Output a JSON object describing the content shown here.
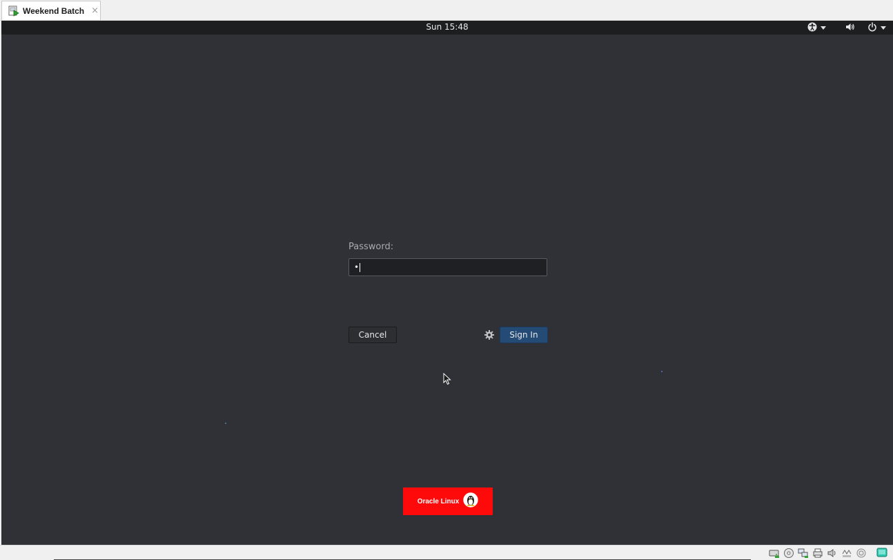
{
  "tab": {
    "label": "Weekend Batch",
    "close_glyph": "×",
    "icon": "vm-running-icon"
  },
  "topbar": {
    "clock": "Sun 15:48",
    "icons": [
      "accessibility-icon",
      "volume-icon",
      "power-icon"
    ]
  },
  "login": {
    "password_label": "Password:",
    "password_value": "•",
    "cancel_label": "Cancel",
    "signin_label": "Sign In",
    "settings_icon": "gear-icon"
  },
  "logo": {
    "text": "Oracle Linux",
    "mascot": "tux-penguin-icon",
    "background": "#ff0a0a"
  },
  "statusbar": {
    "icons": [
      "hard-disk-icon",
      "optical-drive-icon",
      "network-icon",
      "usb-printer-icon",
      "audio-icon",
      "shared-folder-icon",
      "capture-icon",
      "host-key-icon"
    ]
  },
  "colors": {
    "guest_background": "#2f3136",
    "topbar": "#1d1e20",
    "signin_button": "#244b76"
  }
}
